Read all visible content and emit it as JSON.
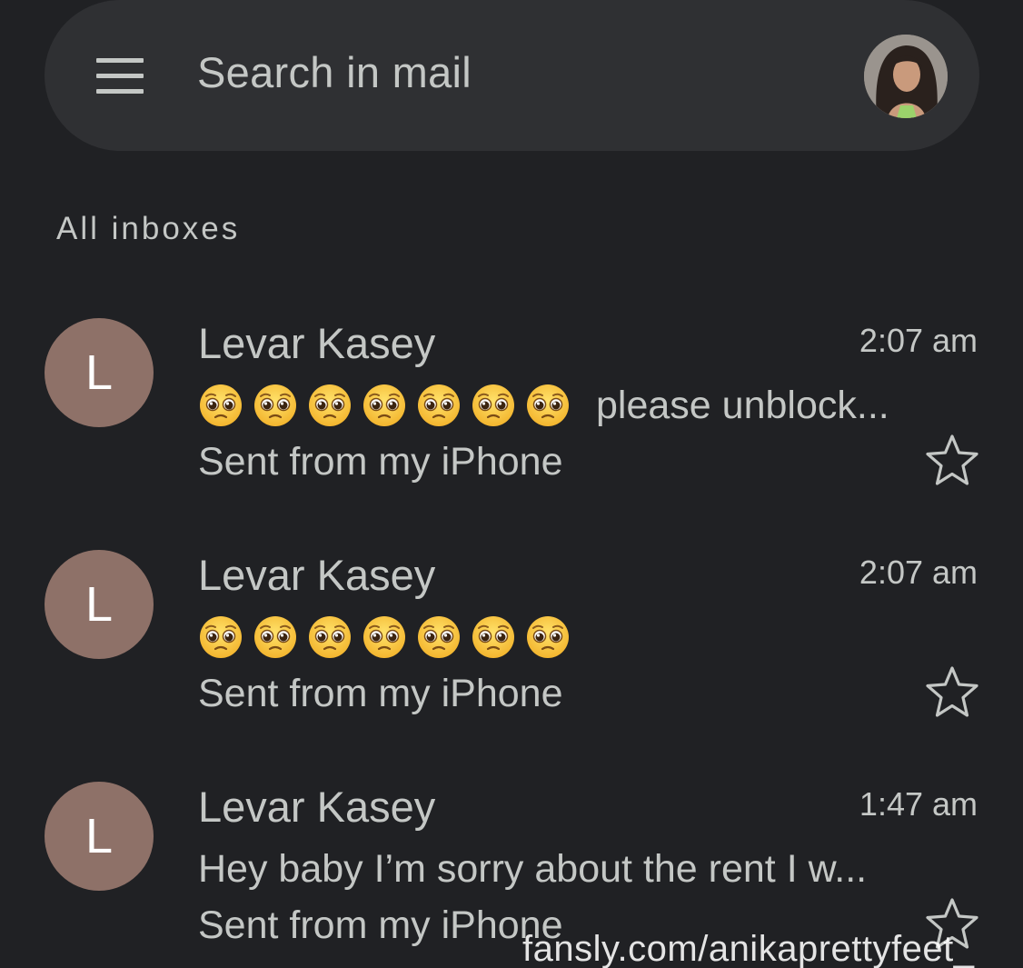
{
  "search": {
    "placeholder": "Search in mail"
  },
  "icons": {
    "menu": "hamburger-menu-icon",
    "star": "star-outline-icon",
    "emoji": "pleading-face-emoji"
  },
  "section_label": "All inboxes",
  "emails": [
    {
      "avatar_letter": "L",
      "sender": "Levar Kasey",
      "time": "2:07 am",
      "subject_emoji_count": 7,
      "subject_text": "please unblock...",
      "snippet": "Sent from my iPhone",
      "starred": false
    },
    {
      "avatar_letter": "L",
      "sender": "Levar Kasey",
      "time": "2:07 am",
      "subject_emoji_count": 7,
      "subject_text": "",
      "snippet": "Sent from my iPhone",
      "starred": false
    },
    {
      "avatar_letter": "L",
      "sender": "Levar Kasey",
      "time": "1:47 am",
      "subject_emoji_count": 0,
      "subject_text": "Hey baby I’m sorry about the rent I w...",
      "snippet": "Sent from my iPhone",
      "starred": false
    }
  ],
  "watermark": "fansly.com/anikaprettyfeet_",
  "colors": {
    "background": "#202124",
    "search_bar": "#2f3033",
    "avatar": "#8e7168",
    "text": "#c4c7c5"
  }
}
